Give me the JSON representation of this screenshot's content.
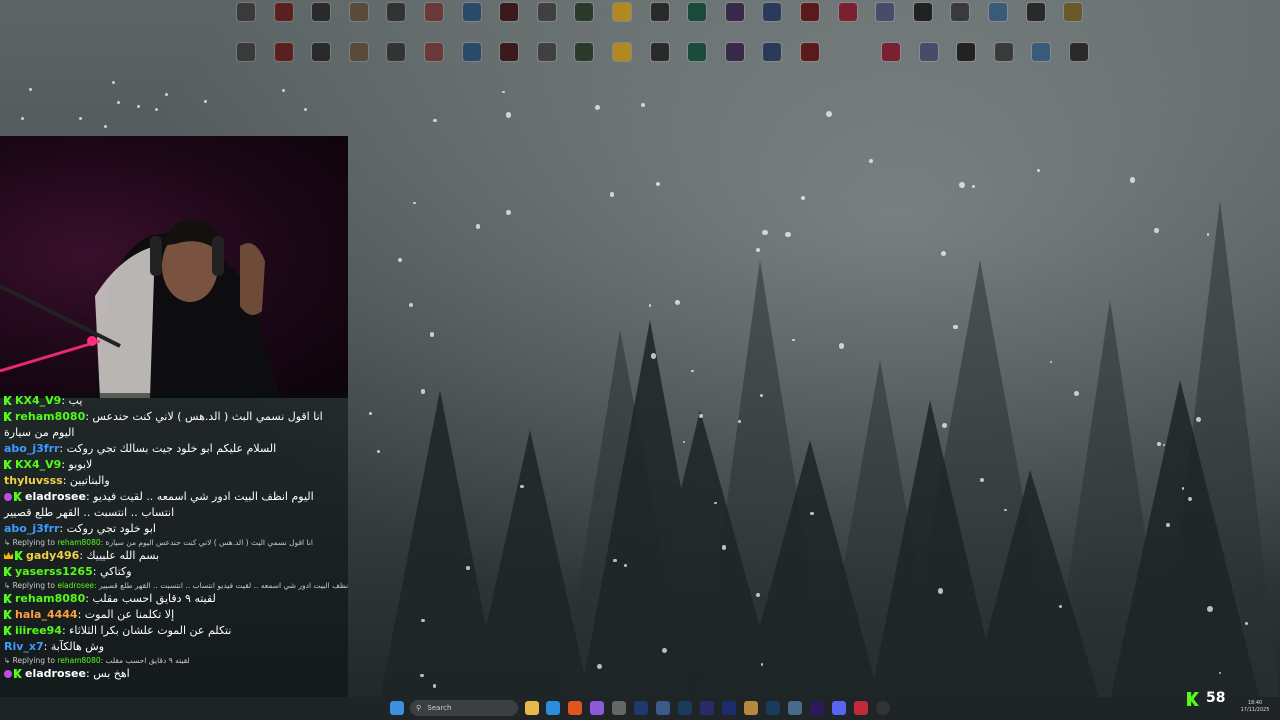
{
  "desktop_icons": {
    "row1": [
      "",
      "",
      "",
      "",
      "",
      "",
      "",
      "",
      "",
      "",
      "",
      "",
      "",
      "",
      "",
      "",
      "",
      "",
      "",
      "",
      "",
      "",
      ""
    ],
    "row2": [
      "",
      "",
      "",
      "",
      "",
      "",
      "",
      "",
      "",
      "",
      "",
      "",
      "",
      "",
      "",
      "",
      "",
      "",
      "",
      "",
      "",
      ""
    ]
  },
  "chat": {
    "messages": [
      {
        "user": "KX4_V9",
        "color": "#53fc18",
        "badges": [
          "kick"
        ],
        "text": "يب"
      },
      {
        "user": "reham8080",
        "color": "#53fc18",
        "badges": [
          "kick"
        ],
        "text": "انا اقول نسمي البث ( الد.هس ) لاني كنت حندعس اليوم من سيارة"
      },
      {
        "user": "abo_j3frr",
        "color": "#3d9bff",
        "badges": [],
        "text": "السلام عليكم ابو خلود جيت بسالك تجي روكت"
      },
      {
        "user": "KX4_V9",
        "color": "#53fc18",
        "badges": [
          "kick"
        ],
        "text": "لابوبو"
      },
      {
        "user": "thyluvsss",
        "color": "#f2d047",
        "badges": [],
        "text": "والبناتيين"
      },
      {
        "user": "eladrosee",
        "color": "#ffffff",
        "badges": [
          "sub",
          "kick"
        ],
        "text": "اليوم انظف البيت ادور شي اسمعه .. لقيت فيديو انتساب .. انتسبت .. القهر طلع قصيير"
      },
      {
        "user": "abo_j3frr",
        "color": "#3d9bff",
        "badges": [],
        "text": "ابو خلود تجي روكت"
      },
      {
        "reply_to": "reham8080",
        "reply_text": "انا اقول نسمي البث ( الد.هس ) لاني كنت حندعس اليوم من سيارة",
        "reply_label": "Replying to"
      },
      {
        "user": "gady496",
        "color": "#f2d047",
        "badges": [
          "crown",
          "kick"
        ],
        "text": "بسم الله عليييك"
      },
      {
        "user": "yaserss1265",
        "color": "#53fc18",
        "badges": [
          "kick"
        ],
        "text": "وكتاكي"
      },
      {
        "reply_to": "eladrosee",
        "reply_text": "اليوم انظف البيت ادور شي اسمعه .. لقيت فيديو انتساب .. انتسبت .. القهر طلع قصيير",
        "reply_label": "Replying to"
      },
      {
        "user": "reham8080",
        "color": "#53fc18",
        "badges": [
          "kick"
        ],
        "text": "لقيته ٩ دقايق احسب مقلب"
      },
      {
        "user": "hala_4444",
        "color": "#ff9e3d",
        "badges": [
          "kick"
        ],
        "text": "إلا تكلمنا عن الموت"
      },
      {
        "user": "iiiree94",
        "color": "#53fc18",
        "badges": [
          "kick"
        ],
        "text": "نتكلم عن الموت علشان بكرا الثلاثاء"
      },
      {
        "user": "Riv_x7",
        "color": "#3d9bff",
        "badges": [],
        "text": "وش هالكآبة"
      },
      {
        "reply_to": "reham8080",
        "reply_text": "لقيته ٩ دقايق احسب مقلب",
        "reply_label": "Replying to"
      },
      {
        "user": "eladrosee",
        "color": "#ffffff",
        "badges": [
          "sub",
          "kick"
        ],
        "text": "اهخ بس"
      }
    ]
  },
  "taskbar": {
    "search_placeholder": "Search",
    "viewer_count": "58",
    "time": "18:40",
    "date": "17/11/2025"
  }
}
